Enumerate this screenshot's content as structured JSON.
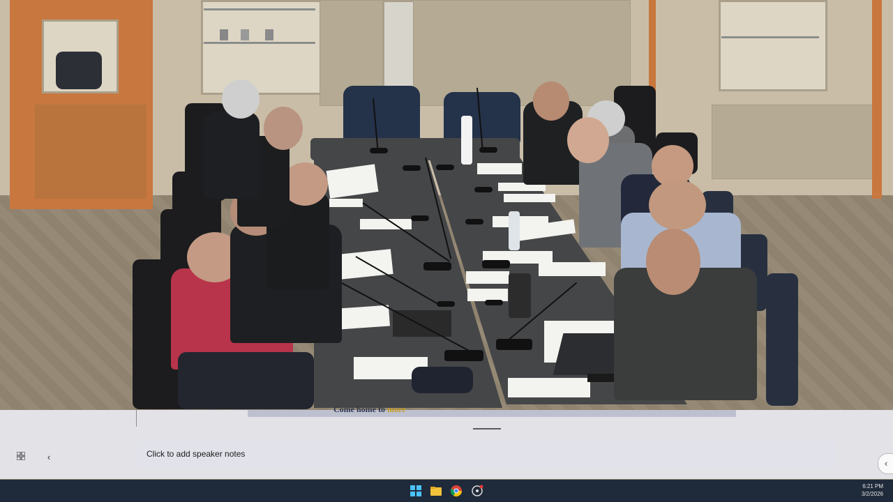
{
  "notes": {
    "placeholder": "Click to add speaker notes"
  },
  "slide_strip": {
    "text_start": "Come home to ",
    "text_highlight": "more"
  },
  "controls": {
    "grid_view_icon": "grid-icon",
    "back_icon": "chevron-left-icon",
    "expand_icon": "chevron-left-icon"
  },
  "taskbar": {
    "icons": [
      "windows-start-icon",
      "file-explorer-icon",
      "chrome-icon",
      "recording-app-icon"
    ],
    "time": "6:21 PM",
    "date": "3/2/2026"
  },
  "colors": {
    "taskbar": "#1f2a3a",
    "notes_bg": "#e8eaf0",
    "highlight": "#c79a1b"
  }
}
